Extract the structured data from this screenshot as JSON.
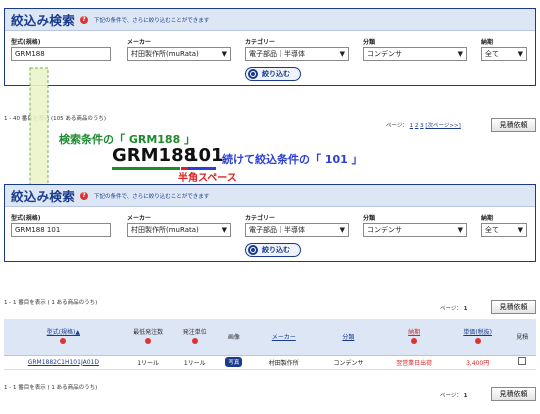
{
  "panel": {
    "title": "絞込み検索",
    "note": "下記の条件で、さらに絞り込むことができます",
    "labels": {
      "model": "型式(規格)",
      "maker": "メーカー",
      "category": "カテゴリー",
      "class": "分類",
      "delivery": "納期"
    },
    "search_button": "絞り込む"
  },
  "first": {
    "model_value": "GRM188",
    "maker": "村田製作所(muRata)",
    "category": "電子部品｜半導体",
    "class": "コンデンサ",
    "delivery": "全て"
  },
  "second": {
    "model_value": "GRM188 101",
    "maker": "村田製作所(muRata)",
    "category": "電子部品｜半導体",
    "class": "コンデンサ",
    "delivery": "全て"
  },
  "top_results": {
    "count_text": "1 - 40 番目を表示 (105 ある商品のうち)",
    "page_label": "ページ：",
    "pages": [
      "1",
      "2",
      "3"
    ],
    "next": "[次ページ>>]",
    "quote_button": "見積依頼"
  },
  "annotation": {
    "label1": "検索条件の「 GRM188 」",
    "big_word1": "GRM188",
    "big_word2": "101",
    "label2": "続けて絞込条件の「 101 」",
    "label3": "半角スペース",
    "colors": {
      "green": "#1e8a2e",
      "blue": "#2a3fd6",
      "red": "#e02020",
      "arrow_fill": "#eaf5c8",
      "arrow_stroke": "#6fa34a"
    }
  },
  "results": {
    "count_text": "1 - 1 番目を表示 ( 1 ある商品のうち)",
    "page_label": "ページ：",
    "page": "1",
    "quote_button": "見積依頼",
    "columns": [
      "型式(規格)▲",
      "最低発注数",
      "発注単位",
      "画像",
      "メーカー",
      "分類",
      "納期",
      "単価(税抜)",
      "見積"
    ],
    "row": {
      "model": "GRM1882C1H101JA01D",
      "min_order": "1リール",
      "unit": "1リール",
      "photo": "写真",
      "maker": "村田製作所",
      "class": "コンデンサ",
      "delivery": "翌営業日出荷",
      "price": "3,400円"
    },
    "bottom_count_text": "1 - 1 番目を表示 ( 1 ある商品のうち)",
    "bottom_page_label": "ページ：",
    "bottom_page": "1",
    "bottom_quote_button": "見積依頼"
  }
}
